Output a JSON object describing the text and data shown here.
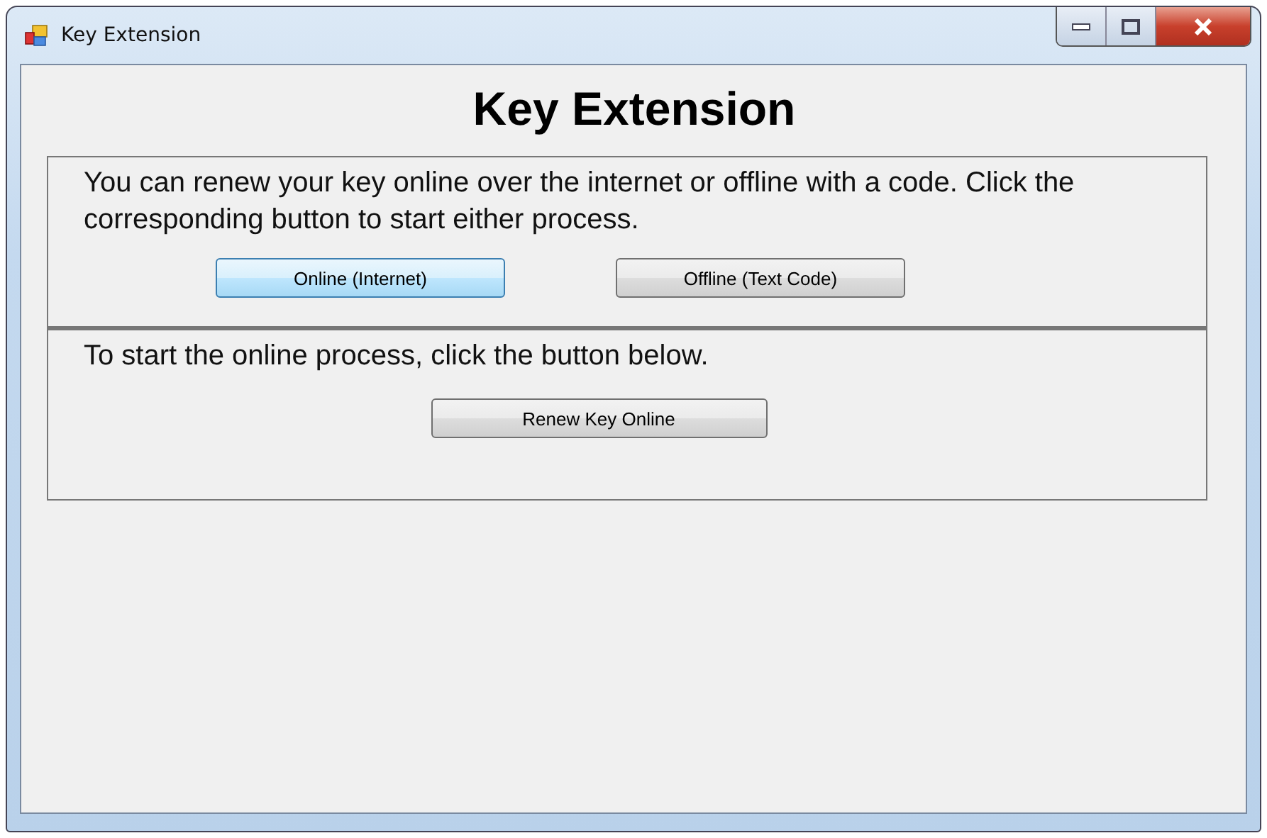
{
  "window": {
    "title": "Key Extension"
  },
  "heading": "Key Extension",
  "method_panel": {
    "text": "You can renew your key online over the internet or offline with a code.  Click the corresponding button to start either process.",
    "buttons": [
      {
        "label": "Online (Internet)",
        "selected": true
      },
      {
        "label": "Offline (Text Code)",
        "selected": false
      }
    ]
  },
  "online_panel": {
    "text": "To start the online process, click the button below.",
    "button": "Renew Key Online"
  }
}
